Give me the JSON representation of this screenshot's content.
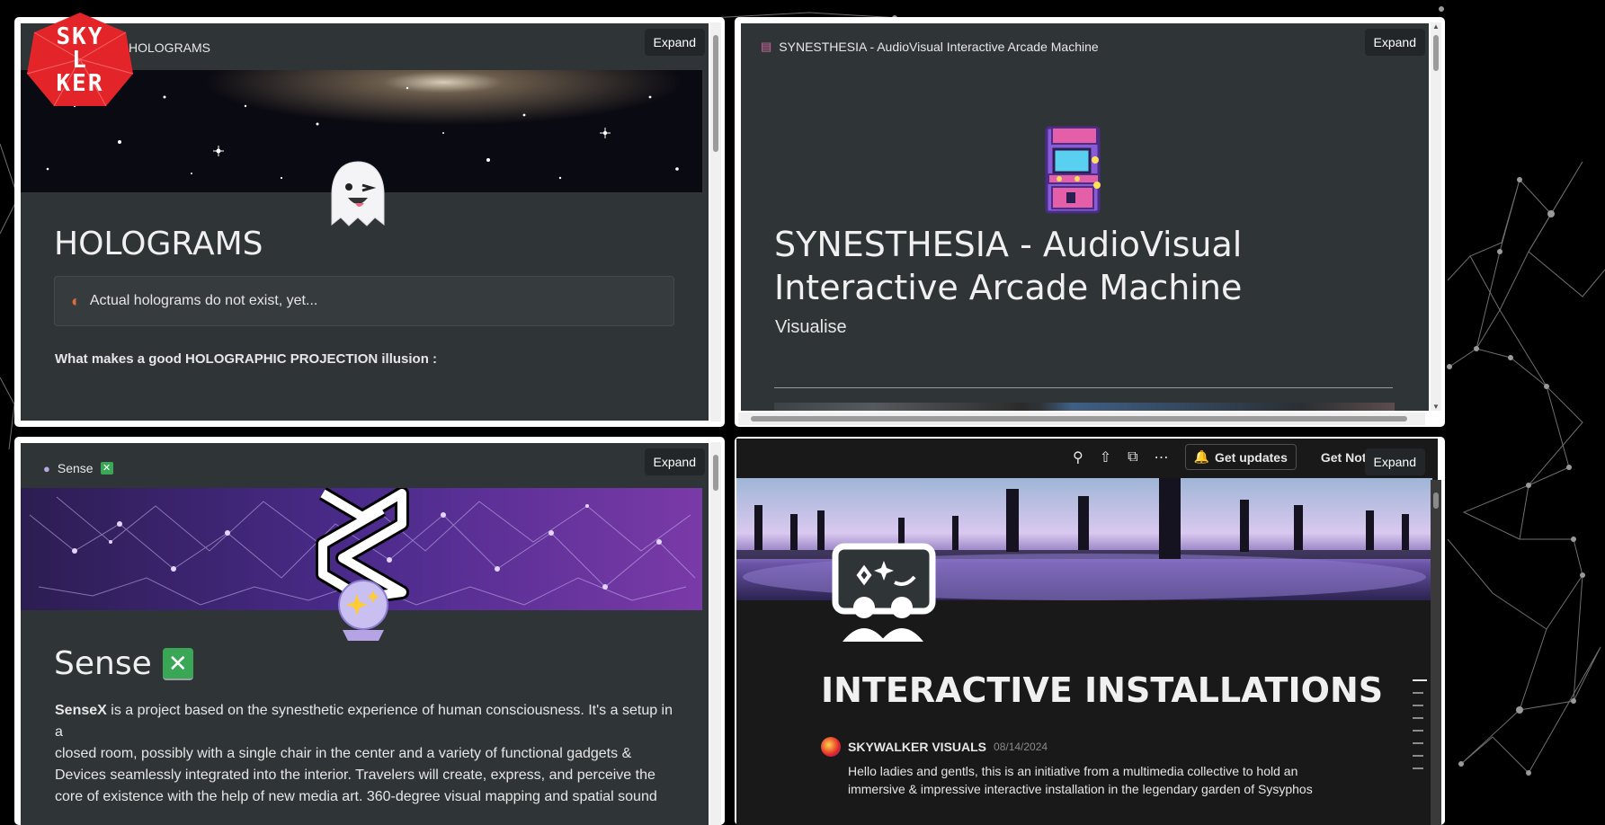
{
  "logo": {
    "lines": [
      "SKY",
      "L",
      "KER"
    ],
    "color": "#e3252a"
  },
  "expand_label": "Expand",
  "panel1": {
    "breadcrumb": "HOLOGRAMS",
    "title": "HOLOGRAMS",
    "callout": "Actual holograms do not exist, yet...",
    "subheading": "What makes a good HOLOGRAPHIC PROJECTION illusion  :"
  },
  "panel2": {
    "breadcrumb": "SYNESTHESIA - AudioVisual Interactive Arcade Machine",
    "title_line1": "SYNESTHESIA - AudioVisual",
    "title_line2": "Interactive Arcade Machine",
    "section": "Visualise"
  },
  "panel3": {
    "breadcrumb": "Sense",
    "title": "Sense",
    "lead_bold": "SenseX",
    "lines": [
      " is a project based on the synesthetic experience of human consciousness. It's a setup in a",
      "closed room, possibly with a single chair in the center and a variety of functional gadgets &",
      "Devices seamlessly integrated into the interior. Travelers will create, express, and perceive the",
      "core of existence with the help of new media art. 360-degree visual mapping and spatial sound"
    ]
  },
  "panel4": {
    "toolbar": {
      "get_updates": "Get updates",
      "get_notion": "Get Notion free"
    },
    "title": "INTERACTIVE INSTALLATIONS",
    "author": "SKYWALKER VISUALS",
    "date": "08/14/2024",
    "intro_line1": "Hello ladies and gentls, this is an initiative from a multimedia collective to hold an",
    "intro_line2": "immersive & impressive interactive installation in the legendary garden of Sysyphos"
  },
  "colors": {
    "accent_red": "#e3252a",
    "panel_bg": "#2f3437",
    "page_bg": "#000000",
    "check_green": "#3aa757"
  }
}
